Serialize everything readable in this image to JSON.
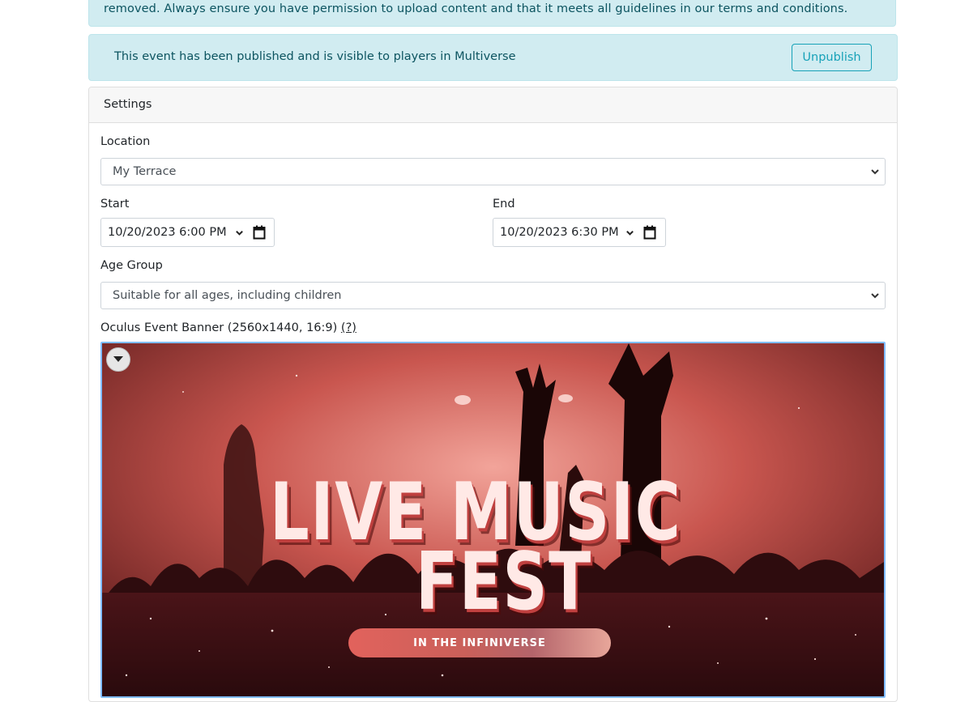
{
  "top_alert": {
    "text": "removed. Always ensure you have permission to upload content and that it meets all guidelines in our terms and conditions."
  },
  "publish_alert": {
    "text": "This event has been published and is visible to players in Multiverse",
    "button_label": "Unpublish"
  },
  "settings": {
    "header": "Settings",
    "location_label": "Location",
    "location_value": "My Terrace",
    "start_label": "Start",
    "start_value": "10/20/2023  6:00   PM",
    "end_label": "End",
    "end_value": "10/20/2023  6:30   PM",
    "age_label": "Age Group",
    "age_value": "Suitable for all ages, including children",
    "banner_label": "Oculus Event Banner (2560x1440, 16:9)",
    "banner_help": "(?)"
  },
  "banner": {
    "line1": "LIVE MUSIC",
    "line2": "FEST",
    "tagline": "IN THE INFINIVERSE"
  },
  "colors": {
    "alert_bg": "#d1ecf1",
    "alert_text": "#0c5460",
    "info_button": "#17a2b8",
    "focus_border": "#80bdff"
  }
}
